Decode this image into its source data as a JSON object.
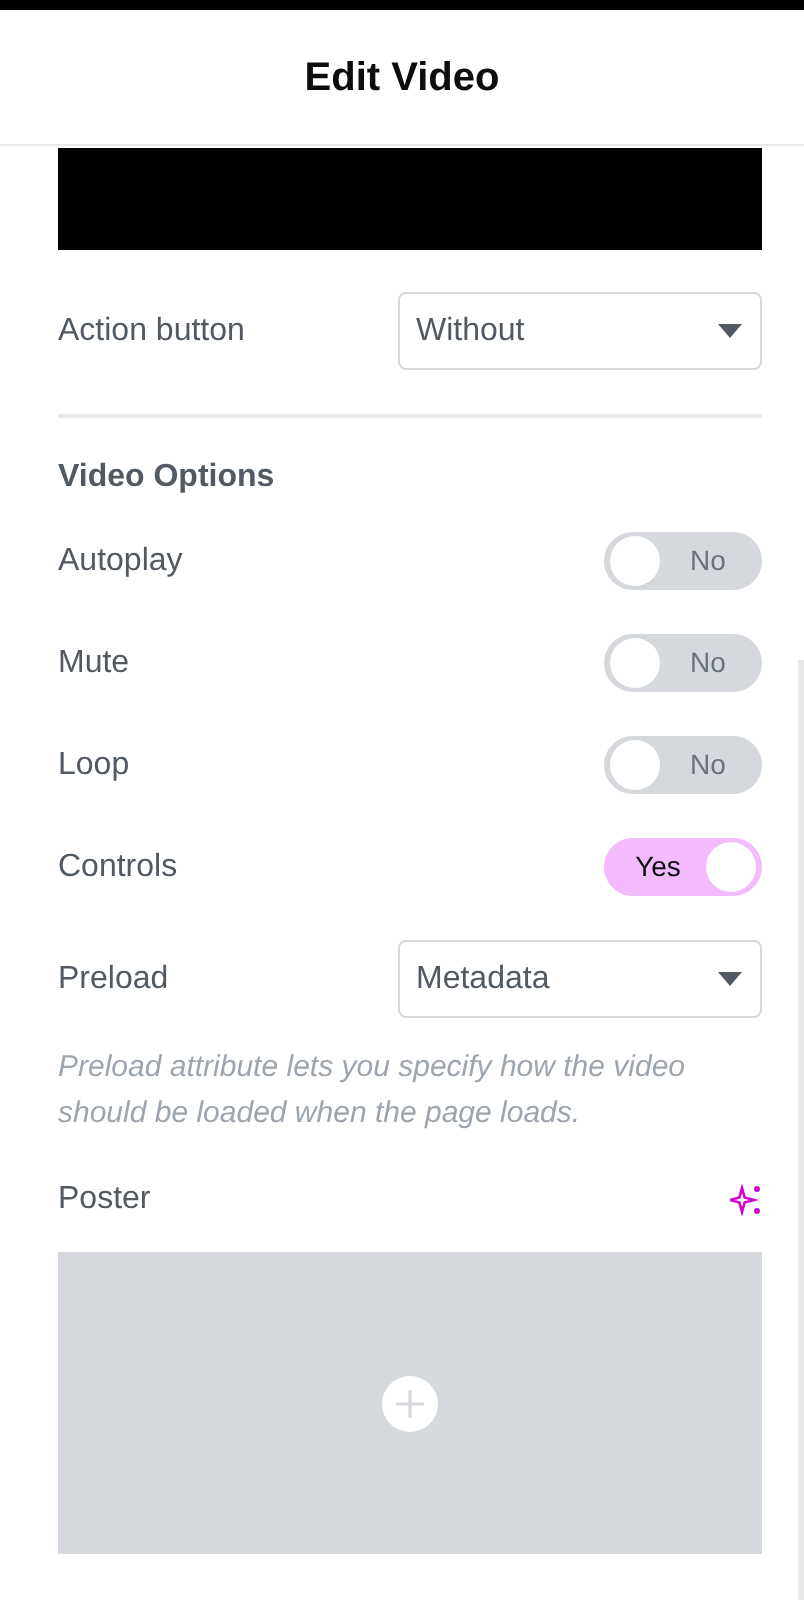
{
  "header": {
    "title": "Edit Video"
  },
  "action_button": {
    "label": "Action button",
    "value": "Without"
  },
  "section": {
    "title": "Video Options"
  },
  "toggles": [
    {
      "label": "Autoplay",
      "on": false,
      "text": "No"
    },
    {
      "label": "Mute",
      "on": false,
      "text": "No"
    },
    {
      "label": "Loop",
      "on": false,
      "text": "No"
    },
    {
      "label": "Controls",
      "on": true,
      "text": "Yes"
    }
  ],
  "preload": {
    "label": "Preload",
    "value": "Metadata",
    "description": "Preload attribute lets you specify how the video should be loaded when the page loads."
  },
  "poster": {
    "label": "Poster"
  }
}
